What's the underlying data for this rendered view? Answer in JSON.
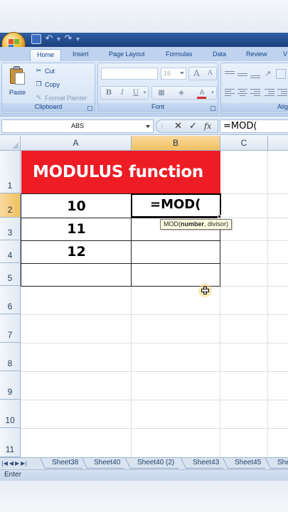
{
  "ribbon": {
    "tabs": [
      "Home",
      "Insert",
      "Page Layout",
      "Formulas",
      "Data",
      "Review",
      "V"
    ],
    "clipboard": {
      "paste_label": "Paste",
      "cut_label": "Cut",
      "copy_label": "Copy",
      "format_painter_label": "Format Painter",
      "group_label": "Clipboard"
    },
    "font": {
      "font_name": "",
      "font_size": "16",
      "group_label": "Font",
      "bold": "B",
      "italic": "I",
      "underline": "U",
      "grow": "A",
      "shrink": "A",
      "color": "A"
    },
    "alignment": {
      "group_label": "Alig"
    }
  },
  "formula_bar": {
    "name_box": "ABS",
    "cancel_icon": "✕",
    "enter_icon": "✓",
    "fx_label": "fx",
    "content": "=MOD("
  },
  "grid": {
    "columns": [
      "A",
      "B",
      "C"
    ],
    "selected_column": "B",
    "rows": [
      "1",
      "2",
      "3",
      "4",
      "5",
      "6",
      "7",
      "8",
      "9",
      "10",
      "11"
    ],
    "selected_row": "2",
    "title_cell": "MODULUS function",
    "values": [
      "10",
      "11",
      "12"
    ],
    "active_cell_text": "=MOD(",
    "tooltip": {
      "func": "MOD(",
      "arg1": "number",
      "rest": ", divisor)"
    }
  },
  "sheet_tabs": [
    "Sheet38",
    "Sheet40",
    "Sheet40 (2)",
    "Sheet43",
    "Sheet45",
    "She"
  ],
  "status": "Enter",
  "colors": {
    "title_fill": "#ee1c25",
    "selected_header": "#f1c15f",
    "ribbon": "#d1e0f3"
  }
}
